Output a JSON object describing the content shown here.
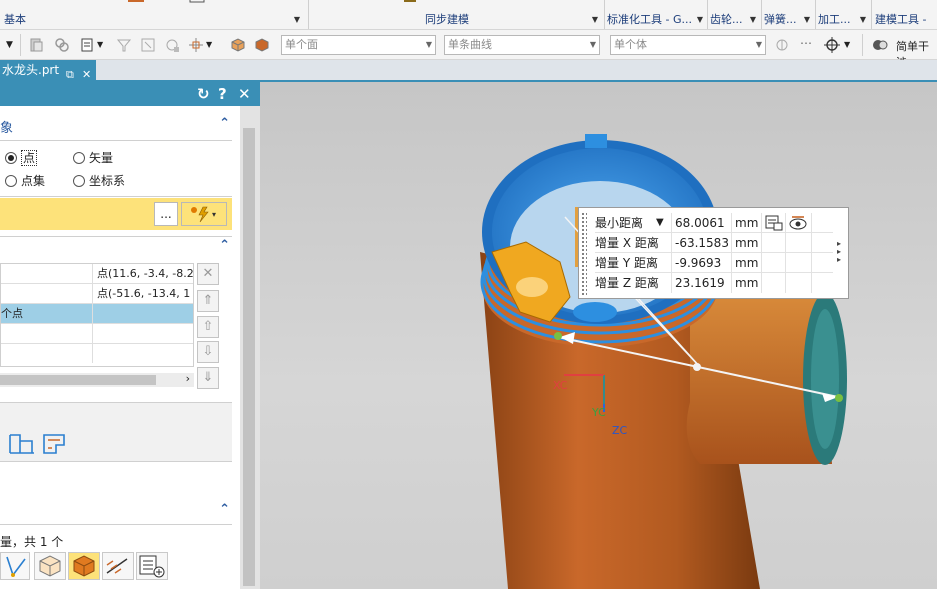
{
  "ribbon": {
    "groups": [
      {
        "label": "基本"
      },
      {
        "label": "同步建模"
      },
      {
        "label": "标准化工具 - G..."
      },
      {
        "label": "齿轮..."
      },
      {
        "label": "弹簧..."
      },
      {
        "label": "加工..."
      },
      {
        "label": "建模工具 - G"
      }
    ]
  },
  "toolbar": {
    "face_filter": "单个面",
    "curve_filter": "单条曲线",
    "body_filter": "单个体",
    "simple_interference": "简单干涉"
  },
  "file_tab": {
    "label": "水龙头.prt"
  },
  "dialog": {
    "section_object": "象",
    "radio_point": "点",
    "radio_vector": "矢量",
    "radio_point_set": "点集",
    "radio_csys": "坐标系",
    "select_dots": "...",
    "list_rows": [
      {
        "col2": "点(11.6, -3.4, -8.2"
      },
      {
        "col2": "点(-51.6, -13.4, 1"
      },
      {
        "col1": "个点",
        "col2": ""
      }
    ],
    "result_text": "量，共 1 个"
  },
  "viewport": {
    "axis_xc": "XC",
    "axis_yc": "YC",
    "axis_zc": "ZC"
  },
  "measure": {
    "rows": [
      {
        "label": "最小距离",
        "value": "68.0061",
        "unit": "mm"
      },
      {
        "label": "增量 X 距离",
        "value": "-63.1583",
        "unit": "mm"
      },
      {
        "label": "增量 Y 距离",
        "value": "-9.9693",
        "unit": "mm"
      },
      {
        "label": "增量 Z 距离",
        "value": "23.1619",
        "unit": "mm"
      }
    ]
  },
  "colors": {
    "accent": "#3a8fb6",
    "selection": "#fde27a",
    "part_orange": "#c9682a",
    "part_blue": "#2d8fe0"
  }
}
